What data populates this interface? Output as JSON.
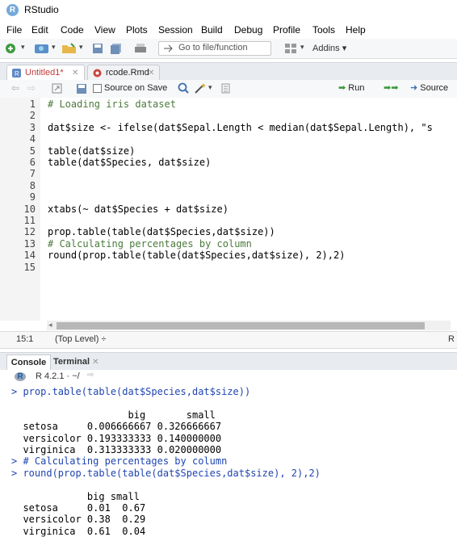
{
  "app": {
    "title": "RStudio",
    "logo_letter": "R"
  },
  "menu": [
    "File",
    "Edit",
    "Code",
    "View",
    "Plots",
    "Session",
    "Build",
    "Debug",
    "Profile",
    "Tools",
    "Help"
  ],
  "toolbar": {
    "goto_placeholder": "Go to file/function",
    "addins_label": "Addins"
  },
  "editor_tabs": [
    {
      "label": "Untitled1*"
    },
    {
      "label": "rcode.Rmd"
    }
  ],
  "editor_toolbar": {
    "source_on_save": "Source on Save",
    "run": "Run",
    "source": "Source"
  },
  "code_lines": [
    {
      "n": "1",
      "text": "# Loading iris dataset",
      "type": "comment"
    },
    {
      "n": "2",
      "text": "",
      "type": "plain"
    },
    {
      "n": "3",
      "text": "dat$size <- ifelse(dat$Sepal.Length < median(dat$Sepal.Length), \"s",
      "type": "plain"
    },
    {
      "n": "4",
      "text": "",
      "type": "plain"
    },
    {
      "n": "5",
      "text": "table(dat$size)",
      "type": "plain"
    },
    {
      "n": "6",
      "text": "table(dat$Species, dat$size)",
      "type": "plain"
    },
    {
      "n": "7",
      "text": "",
      "type": "plain"
    },
    {
      "n": "8",
      "text": "",
      "type": "plain"
    },
    {
      "n": "9",
      "text": "",
      "type": "plain"
    },
    {
      "n": "10",
      "text": "xtabs(~ dat$Species + dat$size)",
      "type": "plain"
    },
    {
      "n": "11",
      "text": "",
      "type": "plain"
    },
    {
      "n": "12",
      "text": "prop.table(table(dat$Species,dat$size))",
      "type": "plain"
    },
    {
      "n": "13",
      "text": "# Calculating percentages by column",
      "type": "comment"
    },
    {
      "n": "14",
      "text": "round(prop.table(table(dat$Species,dat$size), 2),2)",
      "type": "plain"
    },
    {
      "n": "15",
      "text": "",
      "type": "plain"
    }
  ],
  "status": {
    "position": "15:1",
    "scope": "(Top Level) ÷",
    "lang": "R"
  },
  "console_tabs": {
    "console": "Console",
    "terminal": "Terminal"
  },
  "console_head": {
    "version": "R 4.2.1 · ~/"
  },
  "console_lines": [
    {
      "text": "> prop.table(table(dat$Species,dat$size))",
      "type": "input"
    },
    {
      "text": "",
      "type": "output"
    },
    {
      "text": "                    big       small",
      "type": "output"
    },
    {
      "text": "  setosa     0.006666667 0.326666667",
      "type": "output"
    },
    {
      "text": "  versicolor 0.193333333 0.140000000",
      "type": "output"
    },
    {
      "text": "  virginica  0.313333333 0.020000000",
      "type": "output"
    },
    {
      "text": "> # Calculating percentages by column",
      "type": "input"
    },
    {
      "text": "> round(prop.table(table(dat$Species,dat$size), 2),2)",
      "type": "input"
    },
    {
      "text": "",
      "type": "output"
    },
    {
      "text": "             big small",
      "type": "output"
    },
    {
      "text": "  setosa     0.01  0.67",
      "type": "output"
    },
    {
      "text": "  versicolor 0.38  0.29",
      "type": "output"
    },
    {
      "text": "  virginica  0.61  0.04",
      "type": "output"
    }
  ]
}
